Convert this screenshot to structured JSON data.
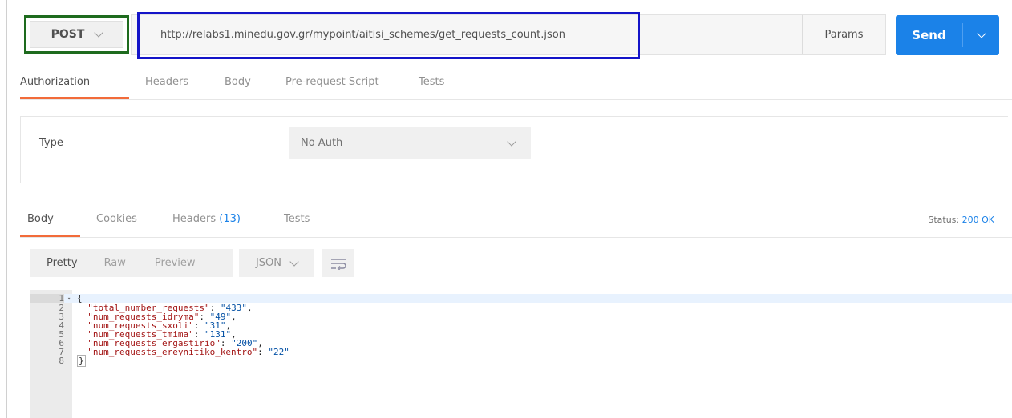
{
  "request": {
    "method": "POST",
    "url": "http://relabs1.minedu.gov.gr/mypoint/aitisi_schemes/get_requests_count.json",
    "params_label": "Params",
    "send_label": "Send"
  },
  "request_tabs": [
    "Authorization",
    "Headers",
    "Body",
    "Pre-request Script",
    "Tests"
  ],
  "auth": {
    "type_label": "Type",
    "type_value": "No Auth"
  },
  "response": {
    "tabs": {
      "body": "Body",
      "cookies": "Cookies",
      "headers": "Headers",
      "headers_count": "(13)",
      "tests": "Tests"
    },
    "status_label": "Status:",
    "status_value": "200 OK",
    "view_modes": [
      "Pretty",
      "Raw",
      "Preview"
    ],
    "format": "JSON",
    "body_lines": [
      {
        "num": "1",
        "text": "{"
      },
      {
        "num": "2",
        "key": "\"total_number_requests\"",
        "value": "\"433\"",
        "trail": ","
      },
      {
        "num": "3",
        "key": "\"num_requests_idryma\"",
        "value": "\"49\"",
        "trail": ","
      },
      {
        "num": "4",
        "key": "\"num_requests_sxoli\"",
        "value": "\"31\"",
        "trail": ","
      },
      {
        "num": "5",
        "key": "\"num_requests_tmima\"",
        "value": "\"131\"",
        "trail": ","
      },
      {
        "num": "6",
        "key": "\"num_requests_ergastirio\"",
        "value": "\"200\"",
        "trail": ","
      },
      {
        "num": "7",
        "key": "\"num_requests_ereynitiko_kentro\"",
        "value": "\"22\"",
        "trail": ""
      },
      {
        "num": "8",
        "text": "}"
      }
    ]
  },
  "colors": {
    "accent_blue": "#1b82e8",
    "tab_underline": "#f26b3a",
    "method_highlight": "#1e6b1e",
    "url_highlight": "#1414c8"
  }
}
